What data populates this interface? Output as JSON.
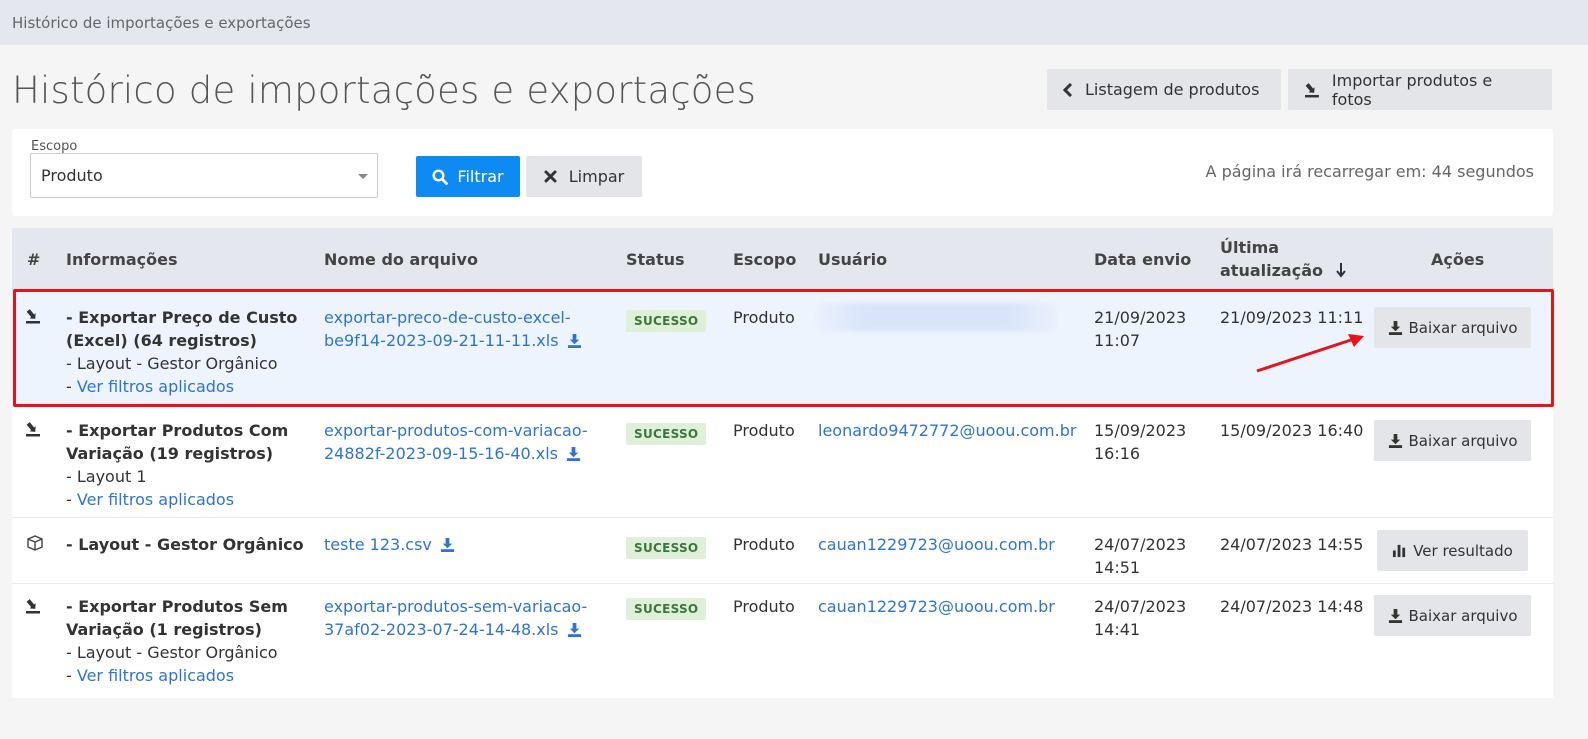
{
  "breadcrumb": "Histórico de importações e exportações",
  "page_title": "Histórico de importações e exportações",
  "header_buttons": {
    "back": "Listagem de produtos",
    "import": "Importar produtos e fotos"
  },
  "filter": {
    "scope_label": "Escopo",
    "scope_value": "Produto",
    "filter_button": "Filtrar",
    "clear_button": "Limpar",
    "reload_text": "A página irá recarregar em: 44 segundos"
  },
  "table": {
    "columns": {
      "index": "#",
      "info": "Informações",
      "file": "Nome do arquivo",
      "status": "Status",
      "scope": "Escopo",
      "user": "Usuário",
      "sent": "Data envio",
      "updated_line1": "Última",
      "updated_line2": "atualização",
      "actions": "Ações"
    },
    "rows": [
      {
        "type_icon": "export-icon",
        "title_line1": "- Exportar Preço de Custo",
        "title_line2": "(Excel) (64 registros)",
        "layout": "- Layout - Gestor Orgânico",
        "filters_prefix": "- ",
        "filters_link": "Ver filtros aplicados",
        "file_line1": "exportar-preco-de-custo-excel-",
        "file_line2": "be9f14-2023-09-21-11-11.xls",
        "status": "SUCESSO",
        "scope": "Produto",
        "user": "",
        "sent_date": "21/09/2023",
        "sent_time": "11:07",
        "updated": "21/09/2023 11:11",
        "action": "Baixar arquivo"
      },
      {
        "type_icon": "export-icon",
        "title_line1": "- Exportar Produtos Com",
        "title_line2": "Variação (19 registros)",
        "layout": "- Layout 1",
        "filters_prefix": "- ",
        "filters_link": "Ver filtros aplicados",
        "file_line1": "exportar-produtos-com-variacao-",
        "file_line2": "24882f-2023-09-15-16-40.xls",
        "status": "SUCESSO",
        "scope": "Produto",
        "user": "leonardo9472772@uoou.com.br",
        "sent_date": "15/09/2023",
        "sent_time": "16:16",
        "updated": "15/09/2023 16:40",
        "action": "Baixar arquivo"
      },
      {
        "type_icon": "box-icon",
        "title_line1": "- Layout - Gestor Orgânico",
        "file_line1": "teste 123.csv",
        "status": "SUCESSO",
        "scope": "Produto",
        "user": "cauan1229723@uoou.com.br",
        "sent_date": "24/07/2023",
        "sent_time": "14:51",
        "updated": "24/07/2023 14:55",
        "action": "Ver resultado"
      },
      {
        "type_icon": "export-icon",
        "title_line1": "- Exportar Produtos Sem",
        "title_line2": "Variação (1 registros)",
        "layout": "- Layout - Gestor Orgânico",
        "filters_prefix": "- ",
        "filters_link": "Ver filtros aplicados",
        "file_line1": "exportar-produtos-sem-variacao-",
        "file_line2": "37af02-2023-07-24-14-48.xls",
        "status": "SUCESSO",
        "scope": "Produto",
        "user": "cauan1229723@uoou.com.br",
        "sent_date": "24/07/2023",
        "sent_time": "14:41",
        "updated": "24/07/2023 14:48",
        "action": "Baixar arquivo"
      }
    ]
  }
}
